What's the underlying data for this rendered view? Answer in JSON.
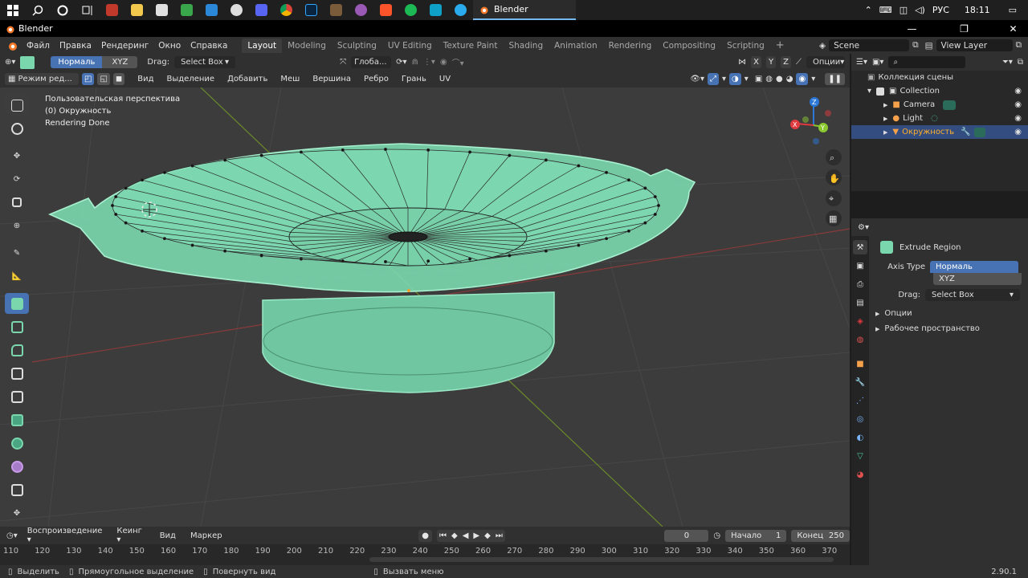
{
  "taskbar": {
    "window_label": "Blender",
    "lang": "РУС",
    "time": "18:11"
  },
  "titlebar": {
    "title": "Blender"
  },
  "menu": {
    "items": [
      "Файл",
      "Правка",
      "Рендеринг",
      "Окно",
      "Справка"
    ],
    "tabs": [
      "Layout",
      "Modeling",
      "Sculpting",
      "UV Editing",
      "Texture Paint",
      "Shading",
      "Animation",
      "Rendering",
      "Compositing",
      "Scripting"
    ],
    "active_tab": "Layout",
    "scene": "Scene",
    "view_layer": "View Layer"
  },
  "tool_header": {
    "normal": "Нормаль",
    "xyz": "XYZ",
    "drag_label": "Drag:",
    "drag_value": "Select Box",
    "orientation": "Глоба...",
    "axes": [
      "X",
      "Y",
      "Z"
    ],
    "options": "Опции"
  },
  "edit_header": {
    "mode": "Режим ред...",
    "menus": [
      "Вид",
      "Выделение",
      "Добавить",
      "Меш",
      "Вершина",
      "Ребро",
      "Грань",
      "UV"
    ]
  },
  "viewport": {
    "perspective": "Пользовательская перспектива",
    "object": "(0) Окружность",
    "status": "Rendering Done",
    "gizmo": {
      "x": "X",
      "y": "Y",
      "z": "Z"
    }
  },
  "outliner": {
    "scene_collection": "Коллекция сцены",
    "collection": "Collection",
    "items": [
      "Camera",
      "Light",
      "Окружность"
    ]
  },
  "properties": {
    "title": "Extrude Region",
    "axis_type_label": "Axis Type",
    "axis_options": [
      "Нормаль",
      "XYZ"
    ],
    "drag_label": "Drag:",
    "drag_value": "Select Box",
    "sections": [
      "Опции",
      "Рабочее пространство"
    ]
  },
  "timeline": {
    "playback": "Воспроизведение",
    "keying": "Кеинг",
    "view": "Вид",
    "marker": "Маркер",
    "current_frame": "0",
    "start_label": "Начало",
    "start_value": "1",
    "end_label": "Конец",
    "end_value": "250",
    "ruler": [
      "110",
      "120",
      "130",
      "140",
      "150",
      "160",
      "170",
      "180",
      "190",
      "200",
      "210",
      "220",
      "230",
      "240",
      "250",
      "260",
      "270",
      "280",
      "290",
      "300",
      "310",
      "320",
      "330",
      "340",
      "350",
      "360",
      "370"
    ]
  },
  "statusbar": {
    "select": "Выделить",
    "box_select": "Прямоугольное выделение",
    "rotate": "Повернуть вид",
    "call_menu": "Вызвать меню",
    "version": "2.90.1"
  },
  "colors": {
    "accent": "#4772b3",
    "mesh": "#7ad6ad",
    "selected_text": "#ffaf29"
  }
}
